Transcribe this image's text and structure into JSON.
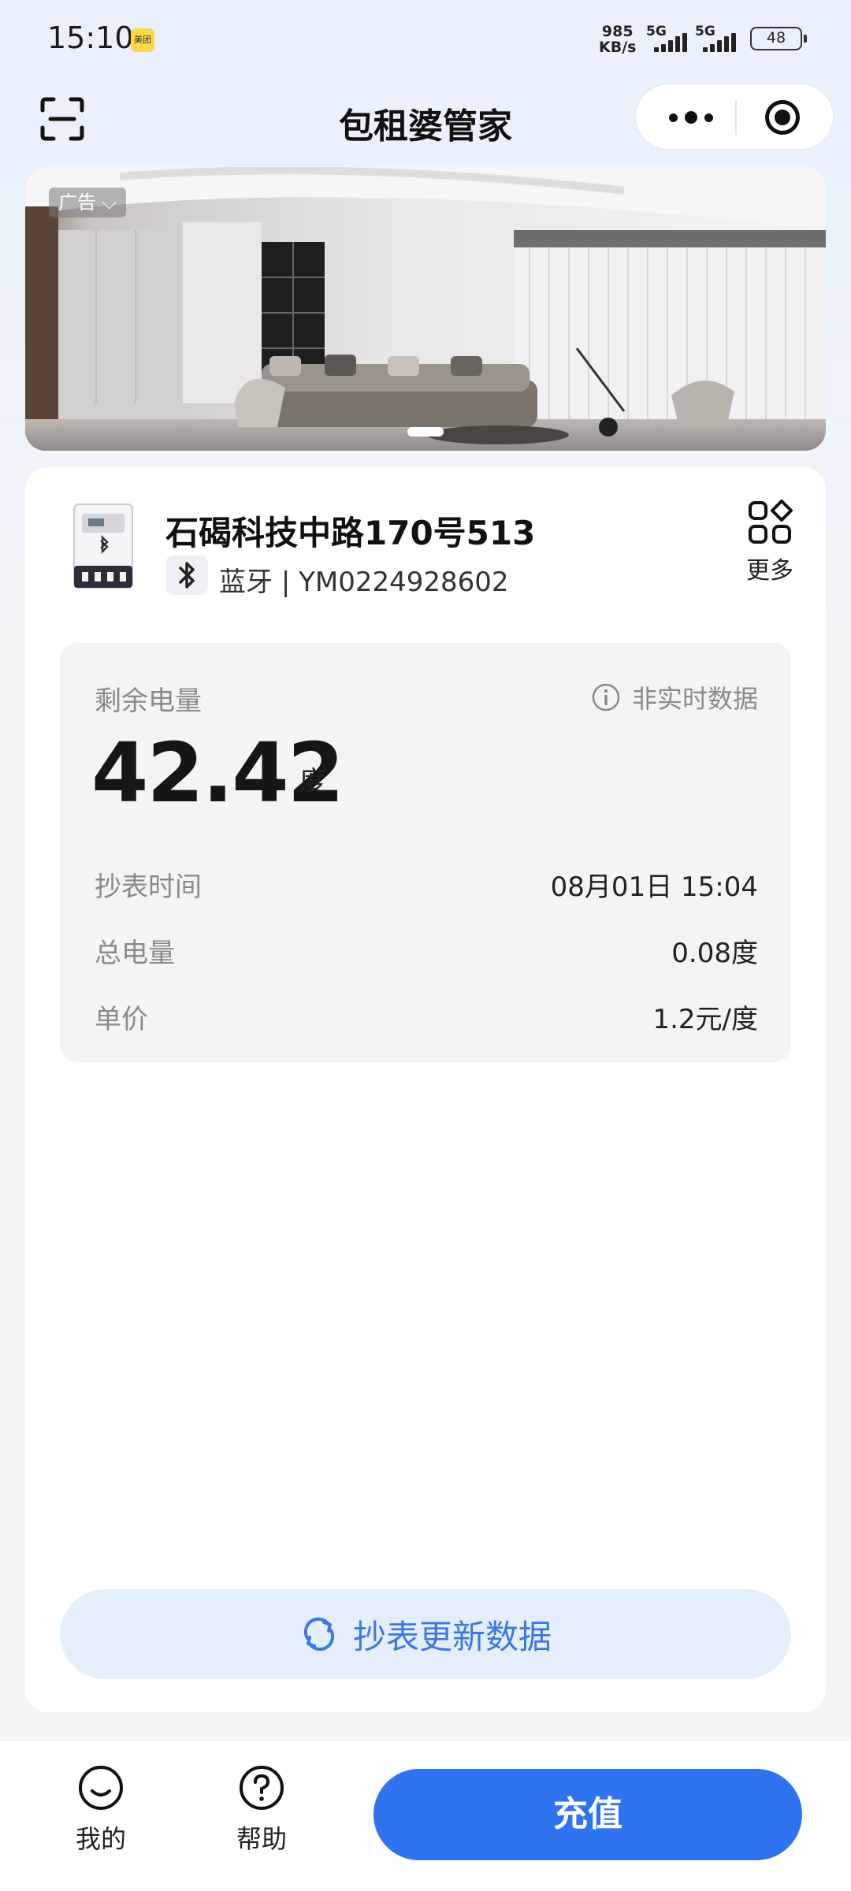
{
  "status_bar": {
    "time": "15:10",
    "app_badge": "美团",
    "net_speed_value": "985",
    "net_speed_unit": "KB/s",
    "signal1_label": "5G",
    "signal2_label": "5G",
    "battery": "48"
  },
  "nav": {
    "title": "包租婆管家",
    "icons": [
      "scan-icon",
      "more-dots-icon",
      "close-target-icon"
    ]
  },
  "banner": {
    "ad_tag": "广告",
    "indicator_count": 1,
    "image": "living-room-ad-image"
  },
  "device": {
    "title": "石碣科技中路170号513",
    "connection": "蓝牙",
    "separator": "|",
    "serial": "YM0224928602",
    "more_label": "更多"
  },
  "meter": {
    "remain_label": "剩余电量",
    "realtime_note": "非实时数据",
    "remain_value": "42.42",
    "remain_unit": "度",
    "rows": [
      {
        "label": "抄表时间",
        "value": "08月01日 15:04"
      },
      {
        "label": "总电量",
        "value": "0.08度"
      },
      {
        "label": "单价",
        "value": "1.2元/度"
      }
    ]
  },
  "actions": {
    "refresh_label": "抄表更新数据",
    "recharge_label": "充值"
  },
  "tabs": [
    {
      "label": "我的",
      "icon": "smile-icon"
    },
    {
      "label": "帮助",
      "icon": "help-icon"
    }
  ],
  "colors": {
    "accent": "#2f73f1",
    "refresh_bg": "#e5effc",
    "refresh_text": "#3b78e0"
  }
}
